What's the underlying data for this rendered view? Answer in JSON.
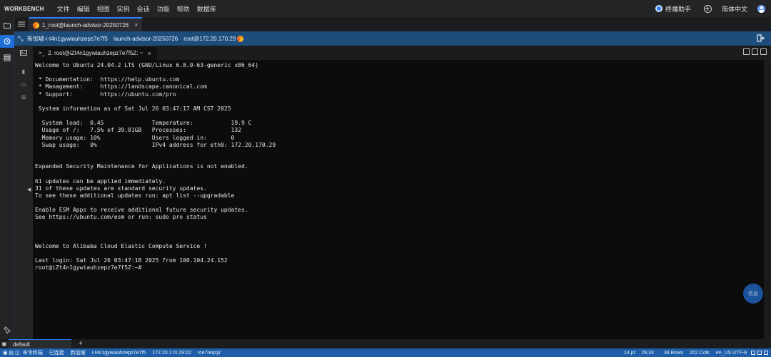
{
  "app": {
    "brand": "WORKBENCH",
    "menu": [
      "文件",
      "编辑",
      "视图",
      "实例",
      "会话",
      "功能",
      "帮助",
      "数据库"
    ],
    "assistant_label": "终端助手",
    "language": "简体中文"
  },
  "session_tab": {
    "label": "1_root@launch-advisor-20250726",
    "close": "×"
  },
  "info_bar": {
    "region": "新加坡-i-t4n1gywiauhzepz7e7f5",
    "instance_name": "launch-advisor-20250726",
    "connection": "root@172.20.170.29"
  },
  "terminal_tab": {
    "prompt_icon": ">_",
    "label": "2. root@iZt4n1gywiauhzepz7e7f5Z: ~",
    "close": "×"
  },
  "terminal": {
    "lines": [
      "Welcome to Ubuntu 24.04.2 LTS (GNU/Linux 6.8.0-63-generic x86_64)",
      "",
      " * Documentation:  https://help.ubuntu.com",
      " * Management:     https://landscape.canonical.com",
      " * Support:        https://ubuntu.com/pro",
      "",
      " System information as of Sat Jul 26 03:47:17 AM CST 2025",
      "",
      "  System load:  0.45              Temperature:           19.9 C",
      "  Usage of /:   7.5% of 39.01GB   Processes:             132",
      "  Memory usage: 10%               Users logged in:       0",
      "  Swap usage:   0%                IPv4 address for eth0: 172.20.170.29",
      "",
      "",
      "Expanded Security Maintenance for Applications is not enabled.",
      "",
      "61 updates can be applied immediately.",
      "31 of these updates are standard security updates.",
      "To see these additional updates run: apt list --upgradable",
      "",
      "Enable ESM Apps to receive additional future security updates.",
      "See https://ubuntu.com/esm or run: sudo pro status",
      "",
      "",
      "",
      "Welcome to Alibaba Cloud Elastic Compute Service !",
      "",
      "Last login: Sat Jul 26 03:47:18 2025 from 100.104.24.152",
      "root@iZt4n1gywiauhzepz7e7f5Z:~#"
    ]
  },
  "float_button": {
    "label": "信息"
  },
  "bottom_tabs": {
    "default_label": "default",
    "add_label": "+"
  },
  "status_bar": {
    "left": [
      "命令终端",
      "已连接",
      "新加坡",
      "i-t4n1gywiauhzepz7e7f5",
      "172.20.170.29:22",
      "rce7reqcjz"
    ],
    "font_size": "14 pt",
    "cursor_pos": "29,33",
    "rows": "38 Rows",
    "cols": "202 Cols",
    "encoding": "en_US.UTF-8"
  },
  "colors": {
    "accent": "#2d7ff9",
    "info_bar": "#1d4d7a",
    "status_bar": "#1e5ea8",
    "terminal_bg": "#0c0c0c"
  },
  "icons": [
    "folder-icon",
    "history-icon",
    "stack-icon",
    "list-icon",
    "terminal-icon",
    "file-icon",
    "window-icon",
    "grid-icon",
    "pin-icon",
    "swirl-icon",
    "close-icon",
    "shrink-icon",
    "logout-icon",
    "split-icon",
    "plus-circle-icon",
    "user-icon"
  ]
}
